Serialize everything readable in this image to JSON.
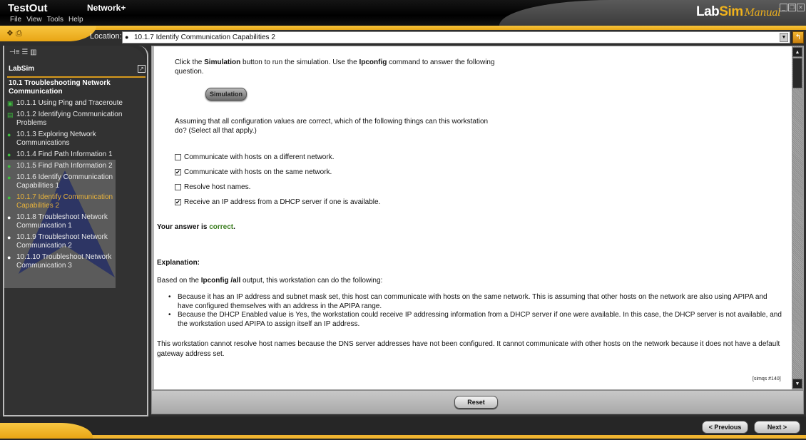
{
  "window": {
    "app_name": "TestOut",
    "course_name": "Network+",
    "logo": {
      "lab": "Lab",
      "sim": "Sim",
      "manual": "Manual"
    },
    "menu": [
      "File",
      "View",
      "Tools",
      "Help"
    ],
    "controls": {
      "minimize": "_",
      "restore": "❐",
      "close": "✕"
    }
  },
  "location": {
    "label": "Location:",
    "value": "10.1.7 Identify Communication Capabilities 2"
  },
  "sidebar": {
    "title": "LabSim",
    "section": "10.1 Troubleshooting Network Communication",
    "items": [
      {
        "label": "10.1.1 Using Ping and Traceroute",
        "icon": "video-icon",
        "status": "completed"
      },
      {
        "label": "10.1.2 Identifying Communication Problems",
        "icon": "document-icon",
        "status": "completed"
      },
      {
        "label": "10.1.3 Exploring Network Communications",
        "icon": "lab-icon",
        "status": "completed"
      },
      {
        "label": "10.1.4 Find Path Information 1",
        "icon": "lab-icon",
        "status": "completed"
      },
      {
        "label": "10.1.5 Find Path Information 2",
        "icon": "lab-icon",
        "status": "completed"
      },
      {
        "label": "10.1.6 Identify Communication Capabilities 1",
        "icon": "lab-icon",
        "status": "completed"
      },
      {
        "label": "10.1.7 Identify Communication Capabilities 2",
        "icon": "lab-icon",
        "status": "active"
      },
      {
        "label": "10.1.8 Troubleshoot Network Communication 1",
        "icon": "lab-icon",
        "status": "not-started"
      },
      {
        "label": "10.1.9 Troubleshoot Network Communication 2",
        "icon": "lab-icon",
        "status": "not-started"
      },
      {
        "label": "10.1.10 Troubleshoot Network Communication 3",
        "icon": "lab-icon",
        "status": "not-started"
      }
    ]
  },
  "content": {
    "intro_pre": "Click the ",
    "intro_b1": "Simulation",
    "intro_mid": " button to run the simulation. Use the ",
    "intro_b2": "Ipconfig",
    "intro_post": " command to answer the following question.",
    "simulation_button": "Simulation",
    "question": "Assuming that all configuration values are correct, which of the following things can this workstation do? (Select all that apply.)",
    "options": [
      {
        "label": "Communicate with hosts on a different network.",
        "checked": false
      },
      {
        "label": "Communicate with hosts on the same network.",
        "checked": true
      },
      {
        "label": "Resolve host names.",
        "checked": false
      },
      {
        "label": "Receive an IP address from a DHCP server if one is available.",
        "checked": true
      }
    ],
    "result_prefix": "Your answer is ",
    "result_value": "correct",
    "result_suffix": ".",
    "explanation_heading": "Explanation:",
    "explanation_pre": "Based on the ",
    "explanation_b": "Ipconfig /all",
    "explanation_post": " output, this workstation can do the following:",
    "bullets": [
      "Because it has an IP address and subnet mask set, this host can communicate with hosts on the same network. This is assuming that other hosts on the network are also using APIPA and have configured themselves with an address in the APIPA range.",
      "Because the DHCP Enabled value is Yes, the workstation could receive IP addressing information from a DHCP server if one were available. In this case, the DHCP server is not available, and the workstation used APIPA to assign itself an IP address."
    ],
    "closing": "This workstation cannot resolve host names because the DNS server addresses have not been configured. It cannot communicate with other hosts on the network because it does not have a default gateway address set.",
    "question_id": "[simqs #140]"
  },
  "buttons": {
    "reset": "Reset",
    "previous": "< Previous",
    "next": "Next >"
  }
}
